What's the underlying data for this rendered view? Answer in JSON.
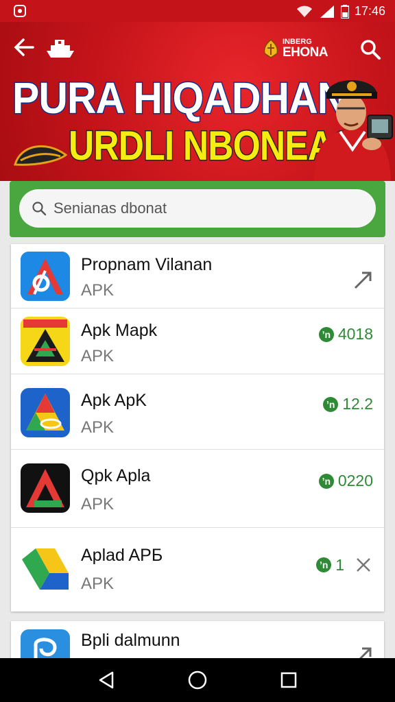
{
  "status_bar": {
    "time": "17:46",
    "icons": [
      "notification-icon",
      "wifi-icon",
      "signal-icon",
      "battery-icon"
    ]
  },
  "banner": {
    "logo_line1": "INBERG",
    "logo_line2": "EHONA",
    "title_line1": "PURA HIQADHAN",
    "title_line2": "URDLI NBONEAS",
    "icons": [
      "back-arrow-icon",
      "ship-icon",
      "garuda-icon",
      "search-icon",
      "hat-icon",
      "officer-illustration"
    ]
  },
  "search": {
    "placeholder": "Senianas dbonat"
  },
  "apps": [
    {
      "name": "Propnam Vilanan",
      "sub": "APK",
      "badge": "",
      "value": "",
      "right_icon": "expand-icon"
    },
    {
      "name": "Apk Mapk",
      "sub": "APK",
      "badge": "ʼn",
      "value": "4018",
      "right_icon": ""
    },
    {
      "name": "Apk ApK",
      "sub": "APK",
      "badge": "ʼn",
      "value": "12.2",
      "right_icon": ""
    },
    {
      "name": "Qpk Apla",
      "sub": "APK",
      "badge": "ʼn",
      "value": "0220",
      "right_icon": ""
    },
    {
      "name": "Aplad APБ",
      "sub": "APK",
      "badge": "ʼn",
      "value": "1",
      "right_icon": "close-icon"
    },
    {
      "name": "Bpli dalmunn",
      "sub": "",
      "badge": "",
      "value": "",
      "right_icon": "expand-icon"
    }
  ],
  "nav": {
    "icons": [
      "nav-back-icon",
      "nav-home-icon",
      "nav-recents-icon"
    ]
  },
  "colors": {
    "brand_red": "#c4141a",
    "search_green": "#4aa63f",
    "value_green": "#2f8a36",
    "title_yellow": "#f6ec12",
    "title_outline_blue": "#0b2f8f"
  }
}
